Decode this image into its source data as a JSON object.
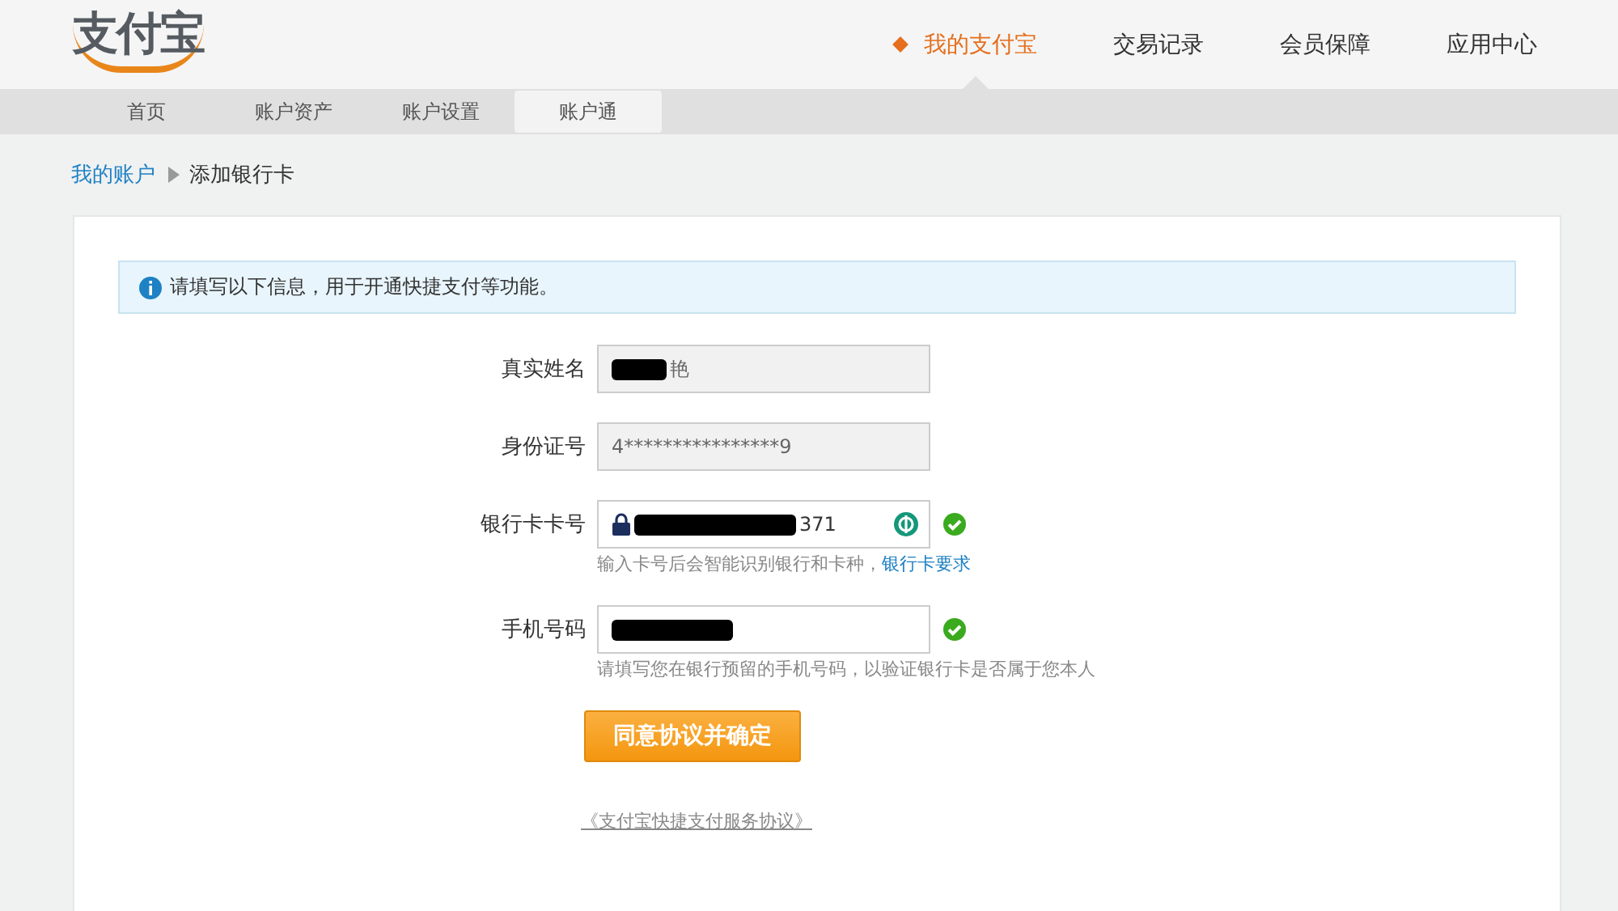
{
  "logo": {
    "text": "支付宝"
  },
  "top_nav": [
    {
      "label": "我的支付宝",
      "selected": true
    },
    {
      "label": "交易记录",
      "selected": false
    },
    {
      "label": "会员保障",
      "selected": false
    },
    {
      "label": "应用中心",
      "selected": false
    }
  ],
  "sub_nav": [
    {
      "label": "首页",
      "selected": false
    },
    {
      "label": "账户资产",
      "selected": false
    },
    {
      "label": "账户设置",
      "selected": false
    },
    {
      "label": "账户通",
      "selected": true
    }
  ],
  "breadcrumb": {
    "link": "我的账户",
    "current": "添加银行卡"
  },
  "notice": "请填写以下信息，用于开通快捷支付等功能。",
  "fields": [
    {
      "label": "真实姓名",
      "value": "艳",
      "redacted": true,
      "disabled": true,
      "valid": false
    },
    {
      "label": "身份证号",
      "value": "4****************9",
      "redacted": false,
      "disabled": true,
      "valid": false
    },
    {
      "label": "银行卡卡号",
      "value": "371",
      "redacted": true,
      "disabled": false,
      "valid": true,
      "secure": true,
      "bank_badge": true,
      "hint": "输入卡号后会智能识别银行和卡种，",
      "hint_link": "银行卡要求"
    },
    {
      "label": "手机号码",
      "redacted": true,
      "disabled": false,
      "valid": true,
      "hint": "请填写您在银行预留的手机号码，以验证银行卡是否属于您本人"
    }
  ],
  "submit": "同意协议并确定",
  "agreement_link": "《支付宝快捷支付服务协议》"
}
